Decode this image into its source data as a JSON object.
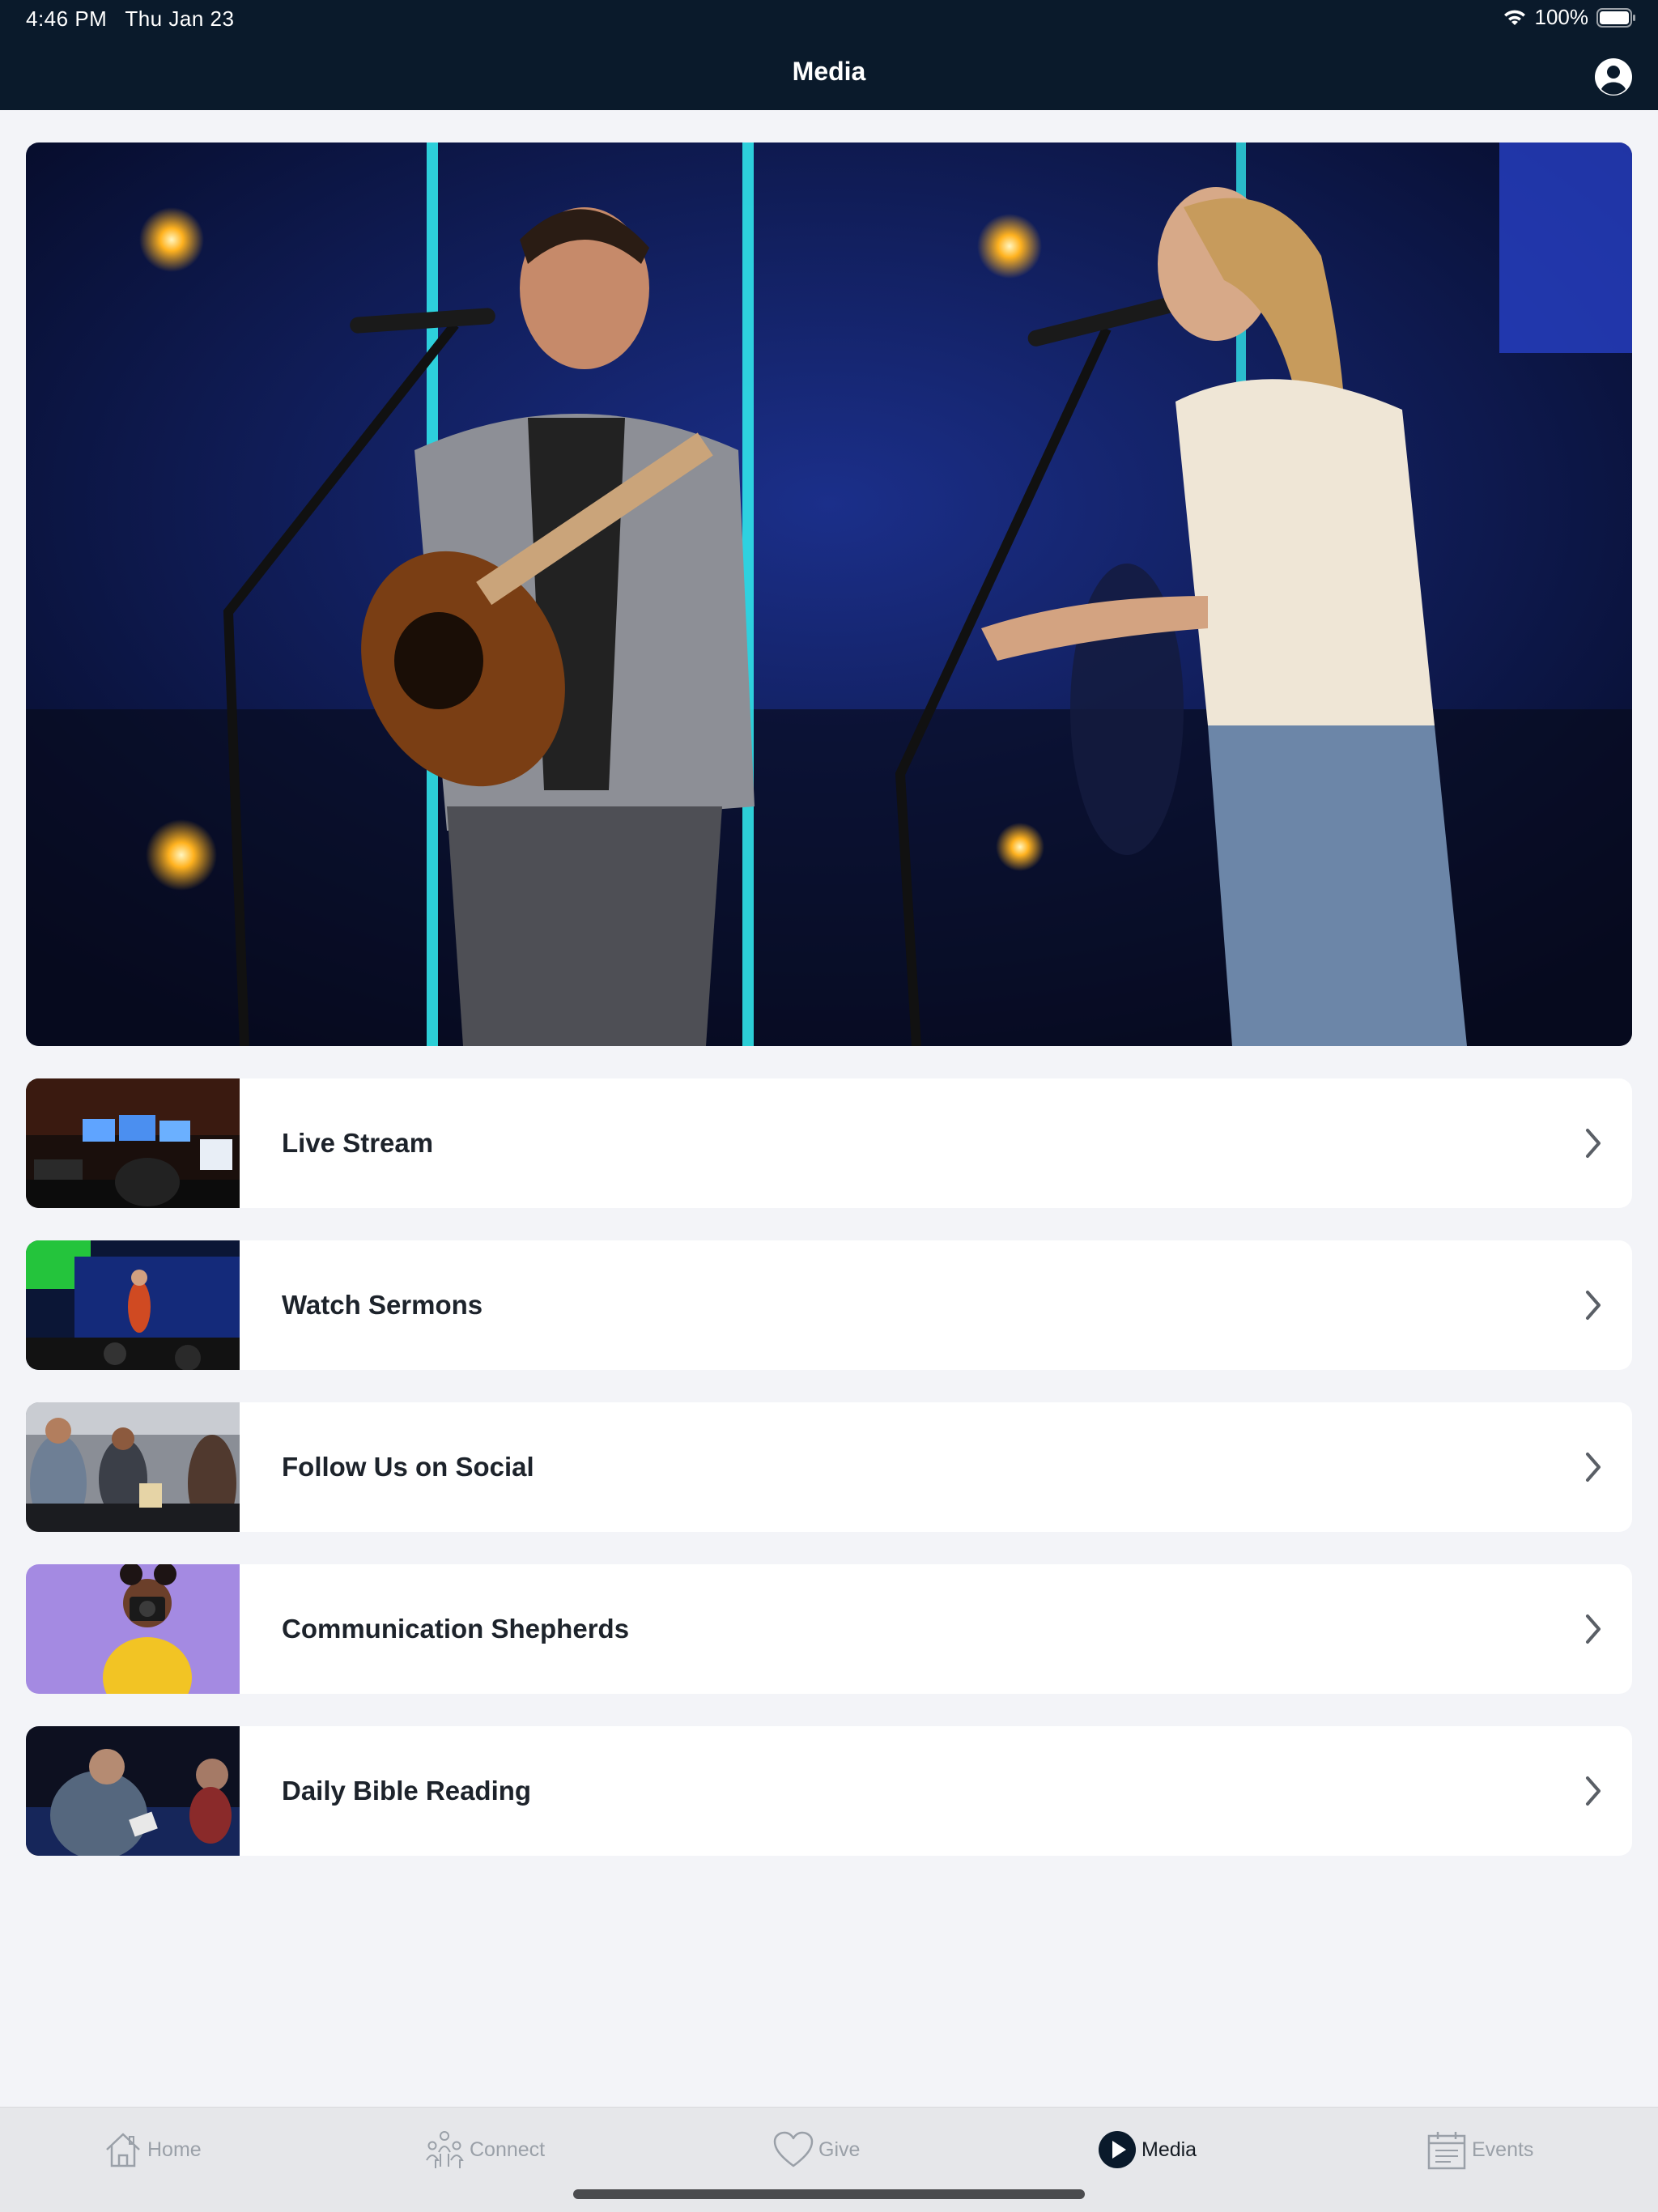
{
  "status_bar": {
    "time": "4:46 PM",
    "date": "Thu Jan 23",
    "battery": "100%",
    "wifi_icon": "wifi-icon",
    "battery_icon": "battery-icon"
  },
  "header": {
    "title": "Media",
    "profile_icon": "user-circle-icon",
    "background": "#0a1a2b"
  },
  "hero": {
    "image": "worship-band-performing-on-stage"
  },
  "media_items": [
    {
      "label": "Live Stream",
      "thumbnail": "production-control-room"
    },
    {
      "label": "Watch Sermons",
      "thumbnail": "pastor-on-stage"
    },
    {
      "label": "Follow Us on Social",
      "thumbnail": "people-at-table"
    },
    {
      "label": "Communication Shepherds",
      "thumbnail": "woman-with-camera"
    },
    {
      "label": "Daily Bible Reading",
      "thumbnail": "people-in-pews"
    }
  ],
  "tabs": [
    {
      "label": "Home",
      "icon": "home-icon",
      "active": false
    },
    {
      "label": "Connect",
      "icon": "people-icon",
      "active": false
    },
    {
      "label": "Give",
      "icon": "heart-icon",
      "active": false
    },
    {
      "label": "Media",
      "icon": "play-icon",
      "active": true
    },
    {
      "label": "Events",
      "icon": "calendar-icon",
      "active": false
    }
  ],
  "colors": {
    "page_background": "#f3f4f8",
    "tabbar_background": "#e6e7ea",
    "inactive_tab": "#9aa0a8",
    "active_tab": "#141a22"
  }
}
